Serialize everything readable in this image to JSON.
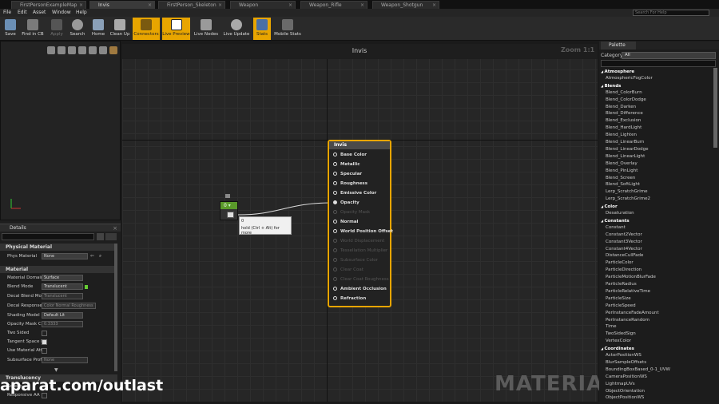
{
  "tabs": [
    {
      "label": "FirstPersonExampleMap"
    },
    {
      "label": "Invis"
    },
    {
      "label": "FirstPerson_Skeleton"
    },
    {
      "label": "Weapon"
    },
    {
      "label": "Weapon_Rifle"
    },
    {
      "label": "Weapon_Shotgun"
    }
  ],
  "menu": [
    "File",
    "Edit",
    "Asset",
    "Window",
    "Help"
  ],
  "help_placeholder": "Search For Help",
  "toolbar": [
    {
      "label": "Save",
      "on": false
    },
    {
      "label": "Find in CB",
      "on": false
    },
    {
      "label": "Apply",
      "on": false
    },
    {
      "label": "Search",
      "on": false
    },
    {
      "label": "Home",
      "on": false
    },
    {
      "label": "Clean Up",
      "on": false
    },
    {
      "label": "Connectors",
      "on": true
    },
    {
      "label": "Live Preview",
      "on": true
    },
    {
      "label": "Live Nodes",
      "on": false
    },
    {
      "label": "Live Update",
      "on": false
    },
    {
      "label": "Stats",
      "on": false
    },
    {
      "label": "Mobile Stats",
      "on": false
    }
  ],
  "details": {
    "tab": "Details",
    "physical_material_header": "Physical Material",
    "phys_label": "Phys Material",
    "phys_value": "None",
    "material_header": "Material",
    "rows": [
      {
        "label": "Material Domain",
        "value": "Surface",
        "type": "select"
      },
      {
        "label": "Blend Mode",
        "value": "Translucent",
        "type": "select"
      },
      {
        "label": "Decal Blend Mode",
        "value": "Translucent",
        "type": "select-dim"
      },
      {
        "label": "Decal Response",
        "value": "Color Normal Roughness",
        "type": "select-dim"
      },
      {
        "label": "Shading Model",
        "value": "Default Lit",
        "type": "select"
      },
      {
        "label": "Opacity Mask Clip",
        "value": "0.3333",
        "type": "select-dim"
      },
      {
        "label": "Two Sided",
        "value": "",
        "type": "check"
      },
      {
        "label": "Tangent Space N",
        "value": "",
        "type": "check-on"
      },
      {
        "label": "Use Material Attr",
        "value": "",
        "type": "check"
      },
      {
        "label": "Subsurface Profil",
        "value": "None",
        "type": "select-dim"
      }
    ],
    "translucency_header": "Translucency",
    "trans_rows": [
      "Screen...",
      "Responsive AA"
    ]
  },
  "graph": {
    "title": "Invis",
    "zoom": "Zoom 1:1",
    "node_title": "Invis",
    "pins": [
      {
        "label": "Base Color",
        "state": "on"
      },
      {
        "label": "Metallic",
        "state": "on"
      },
      {
        "label": "Specular",
        "state": "on"
      },
      {
        "label": "Roughness",
        "state": "on"
      },
      {
        "label": "Emissive Color",
        "state": "on"
      },
      {
        "label": "Opacity",
        "state": "fill"
      },
      {
        "label": "Opacity Mask",
        "state": "off"
      },
      {
        "label": "Normal",
        "state": "on"
      },
      {
        "label": "World Position Offset",
        "state": "on"
      },
      {
        "label": "World Displacement",
        "state": "off"
      },
      {
        "label": "Tessellation Multiplier",
        "state": "off"
      },
      {
        "label": "Subsurface Color",
        "state": "off"
      },
      {
        "label": "Clear Coat",
        "state": "off"
      },
      {
        "label": "Clear Coat Roughness",
        "state": "off"
      },
      {
        "label": "Ambient Occlusion",
        "state": "on"
      },
      {
        "label": "Refraction",
        "state": "on"
      }
    ],
    "const_node_value": "0",
    "tooltip_line1": "0",
    "tooltip_line2": "hold (Ctrl + Alt) for more",
    "watermark": "MATERIAL"
  },
  "credit": "aparat.com/outlast",
  "palette": {
    "tab": "Palette",
    "category_label": "Category:",
    "category_value": "All",
    "items": [
      {
        "t": "Atmosphere",
        "h": true
      },
      {
        "t": "AtmosphericFogColor"
      },
      {
        "t": "Blends",
        "h": true
      },
      {
        "t": "Blend_ColorBurn"
      },
      {
        "t": "Blend_ColorDodge"
      },
      {
        "t": "Blend_Darken"
      },
      {
        "t": "Blend_Difference"
      },
      {
        "t": "Blend_Exclusion"
      },
      {
        "t": "Blend_HardLight"
      },
      {
        "t": "Blend_Lighten"
      },
      {
        "t": "Blend_LinearBurn"
      },
      {
        "t": "Blend_LinearDodge"
      },
      {
        "t": "Blend_LinearLight"
      },
      {
        "t": "Blend_Overlay"
      },
      {
        "t": "Blend_PinLight"
      },
      {
        "t": "Blend_Screen"
      },
      {
        "t": "Blend_SoftLight"
      },
      {
        "t": "Lerp_ScratchGrime"
      },
      {
        "t": "Lerp_ScratchGrime2"
      },
      {
        "t": "Color",
        "h": true
      },
      {
        "t": "Desaturation"
      },
      {
        "t": "Constants",
        "h": true
      },
      {
        "t": "Constant",
        "n": "1"
      },
      {
        "t": "Constant2Vector",
        "n": "2"
      },
      {
        "t": "Constant3Vector",
        "n": "3"
      },
      {
        "t": "Constant4Vector",
        "n": "4"
      },
      {
        "t": "DistanceCullFade"
      },
      {
        "t": "ParticleColor"
      },
      {
        "t": "ParticleDirection"
      },
      {
        "t": "ParticleMotionBlurFade"
      },
      {
        "t": "ParticleRadius"
      },
      {
        "t": "ParticleRelativeTime"
      },
      {
        "t": "ParticleSize"
      },
      {
        "t": "ParticleSpeed"
      },
      {
        "t": "PerInstanceFadeAmount"
      },
      {
        "t": "PerInstanceRandom"
      },
      {
        "t": "Time"
      },
      {
        "t": "TwoSidedSign"
      },
      {
        "t": "VertexColor"
      },
      {
        "t": "Coordinates",
        "h": true
      },
      {
        "t": "ActorPositionWS"
      },
      {
        "t": "BlurSampleOffsets"
      },
      {
        "t": "BoundingBoxBased_0-1_UVW"
      },
      {
        "t": "CameraPositionWS"
      },
      {
        "t": "LightmapUVs"
      },
      {
        "t": "ObjectOrientation"
      },
      {
        "t": "ObjectPositionWS"
      }
    ]
  }
}
